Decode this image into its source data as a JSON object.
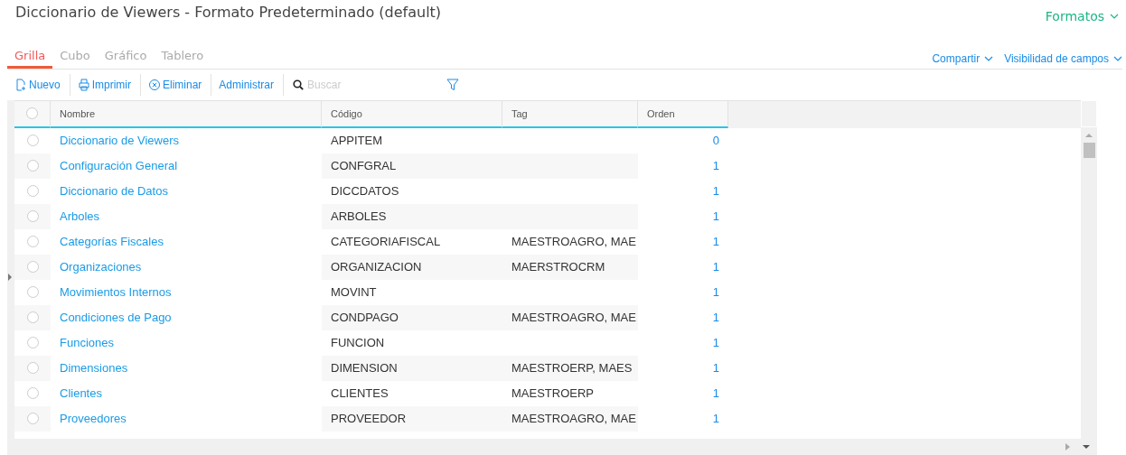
{
  "title": "Diccionario de Viewers - Formato Predeterminado (default)",
  "formats_menu": "Formatos",
  "tabs": [
    {
      "label": "Grilla",
      "selected": true
    },
    {
      "label": "Cubo",
      "selected": false
    },
    {
      "label": "Gráfico",
      "selected": false
    },
    {
      "label": "Tablero",
      "selected": false
    }
  ],
  "menus": [
    "Compartir",
    "Visibilidad de campos"
  ],
  "toolbar": [
    {
      "kind": "new",
      "label": "Nuevo"
    },
    {
      "kind": "print",
      "label": "Imprimir"
    },
    {
      "kind": "delete",
      "label": "Eliminar"
    },
    {
      "kind": "plain",
      "label": "Administrar"
    }
  ],
  "search": {
    "placeholder": "Buscar"
  },
  "table": {
    "select_all": {
      "selected": false
    },
    "columns": [
      "Nombre",
      "Código",
      "Tag",
      "Orden"
    ],
    "rows": [
      {
        "nombre": "Diccionario de Viewers",
        "codigo": "APPITEM",
        "tag": "",
        "orden": "0",
        "selected": false
      },
      {
        "nombre": "Configuración General",
        "codigo": "CONFGRAL",
        "tag": "",
        "orden": "1",
        "selected": false
      },
      {
        "nombre": "Diccionario de Datos",
        "codigo": "DICCDATOS",
        "tag": "",
        "orden": "1",
        "selected": false
      },
      {
        "nombre": "Arboles",
        "codigo": "ARBOLES",
        "tag": "",
        "orden": "1",
        "selected": false
      },
      {
        "nombre": "Categorías Fiscales",
        "codigo": "CATEGORIAFISCAL",
        "tag": "MAESTROAGRO, MAE",
        "orden": "1",
        "selected": false
      },
      {
        "nombre": "Organizaciones",
        "codigo": "ORGANIZACION",
        "tag": "MAERSTROCRM",
        "orden": "1",
        "selected": false
      },
      {
        "nombre": "Movimientos Internos",
        "codigo": "MOVINT",
        "tag": "",
        "orden": "1",
        "selected": false
      },
      {
        "nombre": "Condiciones de Pago",
        "codigo": "CONDPAGO",
        "tag": "MAESTROAGRO, MAE",
        "orden": "1",
        "selected": false
      },
      {
        "nombre": "Funciones",
        "codigo": "FUNCION",
        "tag": "",
        "orden": "1",
        "selected": false
      },
      {
        "nombre": "Dimensiones",
        "codigo": "DIMENSION",
        "tag": "MAESTROERP, MAES",
        "orden": "1",
        "selected": false
      },
      {
        "nombre": "Clientes",
        "codigo": "CLIENTES",
        "tag": "MAESTROERP",
        "orden": "1",
        "selected": false
      },
      {
        "nombre": "Proveedores",
        "codigo": "PROVEEDOR",
        "tag": "MAESTROAGRO, MAE",
        "orden": "1",
        "selected": false
      }
    ]
  }
}
